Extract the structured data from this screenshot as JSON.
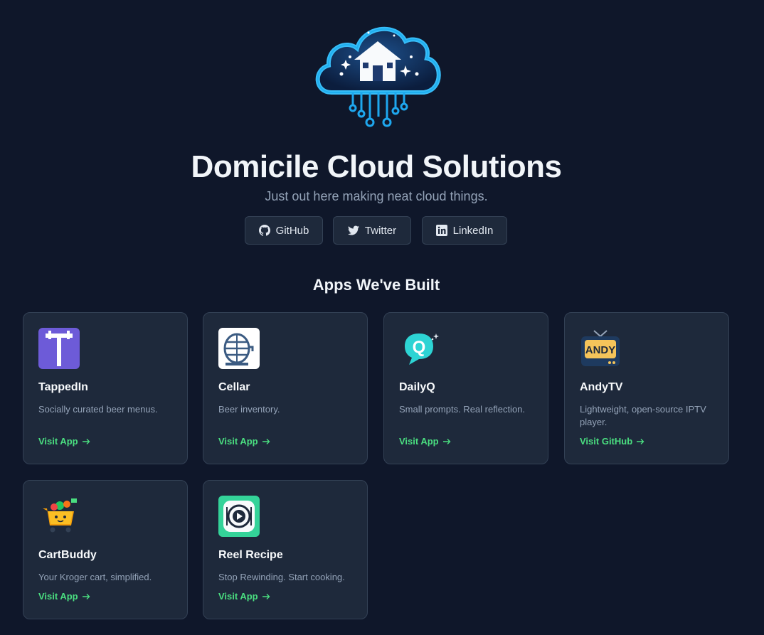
{
  "header": {
    "title": "Domicile Cloud Solutions",
    "subtitle": "Just out here making neat cloud things.",
    "logo_icon": "cloud-house-icon"
  },
  "social": [
    {
      "label": "GitHub",
      "icon": "github-icon"
    },
    {
      "label": "Twitter",
      "icon": "twitter-icon"
    },
    {
      "label": "LinkedIn",
      "icon": "linkedin-icon"
    }
  ],
  "apps_section": {
    "title": "Apps We've Built",
    "apps": [
      {
        "name": "TappedIn",
        "description": "Socially curated beer menus.",
        "link": "Visit App",
        "icon": "tap-handle-icon",
        "icon_bg": "#6d5bd8"
      },
      {
        "name": "Cellar",
        "description": "Beer inventory.",
        "link": "Visit App",
        "icon": "barrel-icon",
        "icon_bg": "#ffffff"
      },
      {
        "name": "DailyQ",
        "description": "Small prompts. Real reflection.",
        "link": "Visit App",
        "icon": "q-bubble-icon",
        "icon_bg": "#1e293b"
      },
      {
        "name": "AndyTV",
        "description": "Lightweight, open-source IPTV player.",
        "link": "Visit GitHub",
        "icon": "tv-icon",
        "icon_bg": "#1e293b"
      },
      {
        "name": "CartBuddy",
        "description": "Your Kroger cart, simplified.",
        "link": "Visit App",
        "icon": "cart-icon",
        "icon_bg": "#1e293b"
      },
      {
        "name": "Reel Recipe",
        "description": "Stop Rewinding. Start cooking.",
        "link": "Visit App",
        "icon": "plate-play-icon",
        "icon_bg": "#34d399"
      }
    ]
  },
  "colors": {
    "background": "#0f172a",
    "card": "#1e293b",
    "border": "#334155",
    "accent_link": "#4ade80",
    "muted_text": "#94a3b8"
  }
}
